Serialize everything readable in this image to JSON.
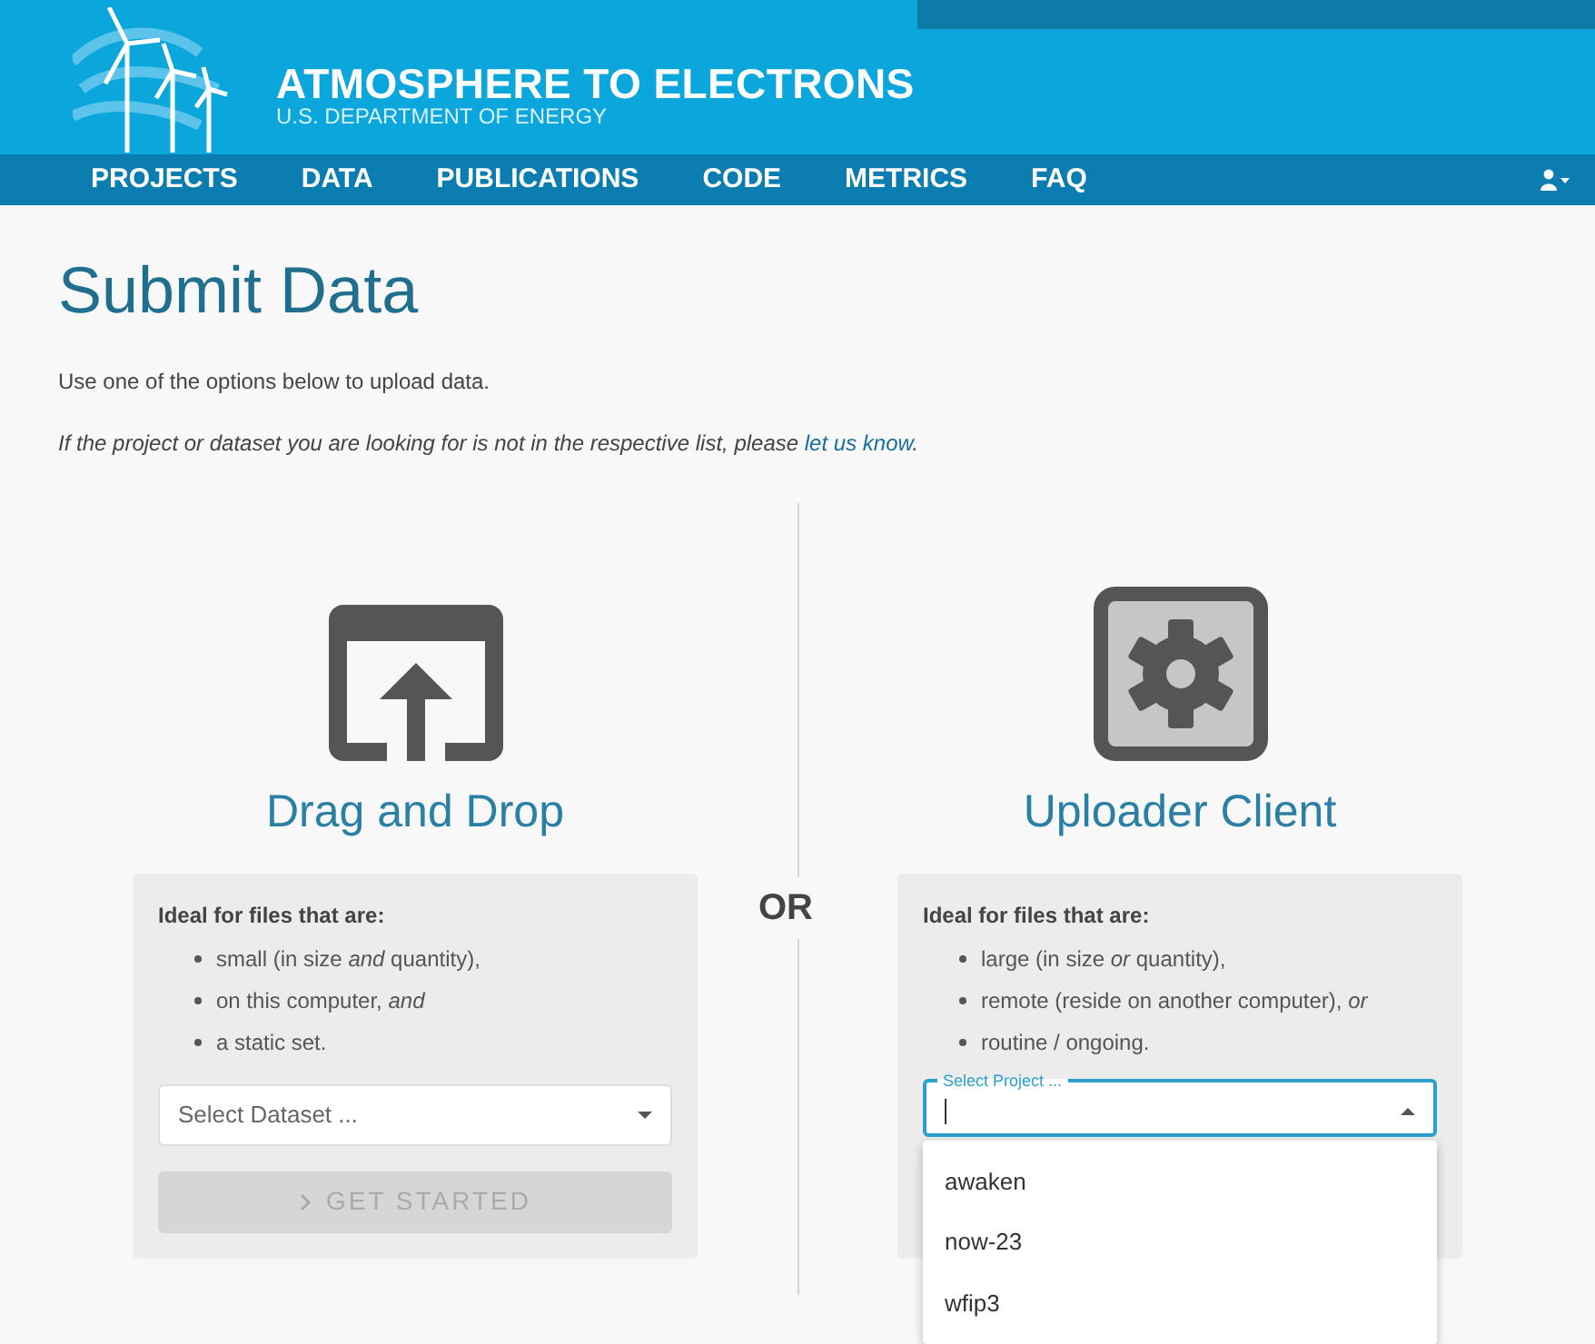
{
  "header": {
    "title": "ATMOSPHERE TO ELECTRONS",
    "subtitle": "U.S. DEPARTMENT OF ENERGY"
  },
  "nav": {
    "items": [
      {
        "label": "PROJECTS"
      },
      {
        "label": "DATA"
      },
      {
        "label": "PUBLICATIONS"
      },
      {
        "label": "CODE"
      },
      {
        "label": "METRICS"
      },
      {
        "label": "FAQ"
      }
    ]
  },
  "page": {
    "title": "Submit Data",
    "intro": "Use one of the options below to upload data.",
    "note": "If the project or dataset you are looking for is not in the respective list, please ",
    "note_link": "let us know",
    "note_end": "."
  },
  "separator": "OR",
  "options": [
    {
      "kind": "upload",
      "title": "Drag and Drop",
      "heading": "Ideal for files that are:",
      "bullets": [
        "small (in size *and* quantity),",
        "on this computer, *and*",
        "a static set."
      ],
      "select": {
        "placeholder": "Select Dataset ...",
        "focused": false,
        "expanded": false
      },
      "button": {
        "label": "GET STARTED",
        "disabled": true
      }
    },
    {
      "kind": "client",
      "title": "Uploader Client",
      "heading": "Ideal for files that are:",
      "bullets": [
        "large (in size *or* quantity),",
        "remote (reside on another computer), *or*",
        "routine / ongoing."
      ],
      "select": {
        "placeholder": "Select Project ...",
        "focused": true,
        "expanded": true,
        "options": [
          "awaken",
          "now-23",
          "wfip3"
        ]
      }
    }
  ]
}
